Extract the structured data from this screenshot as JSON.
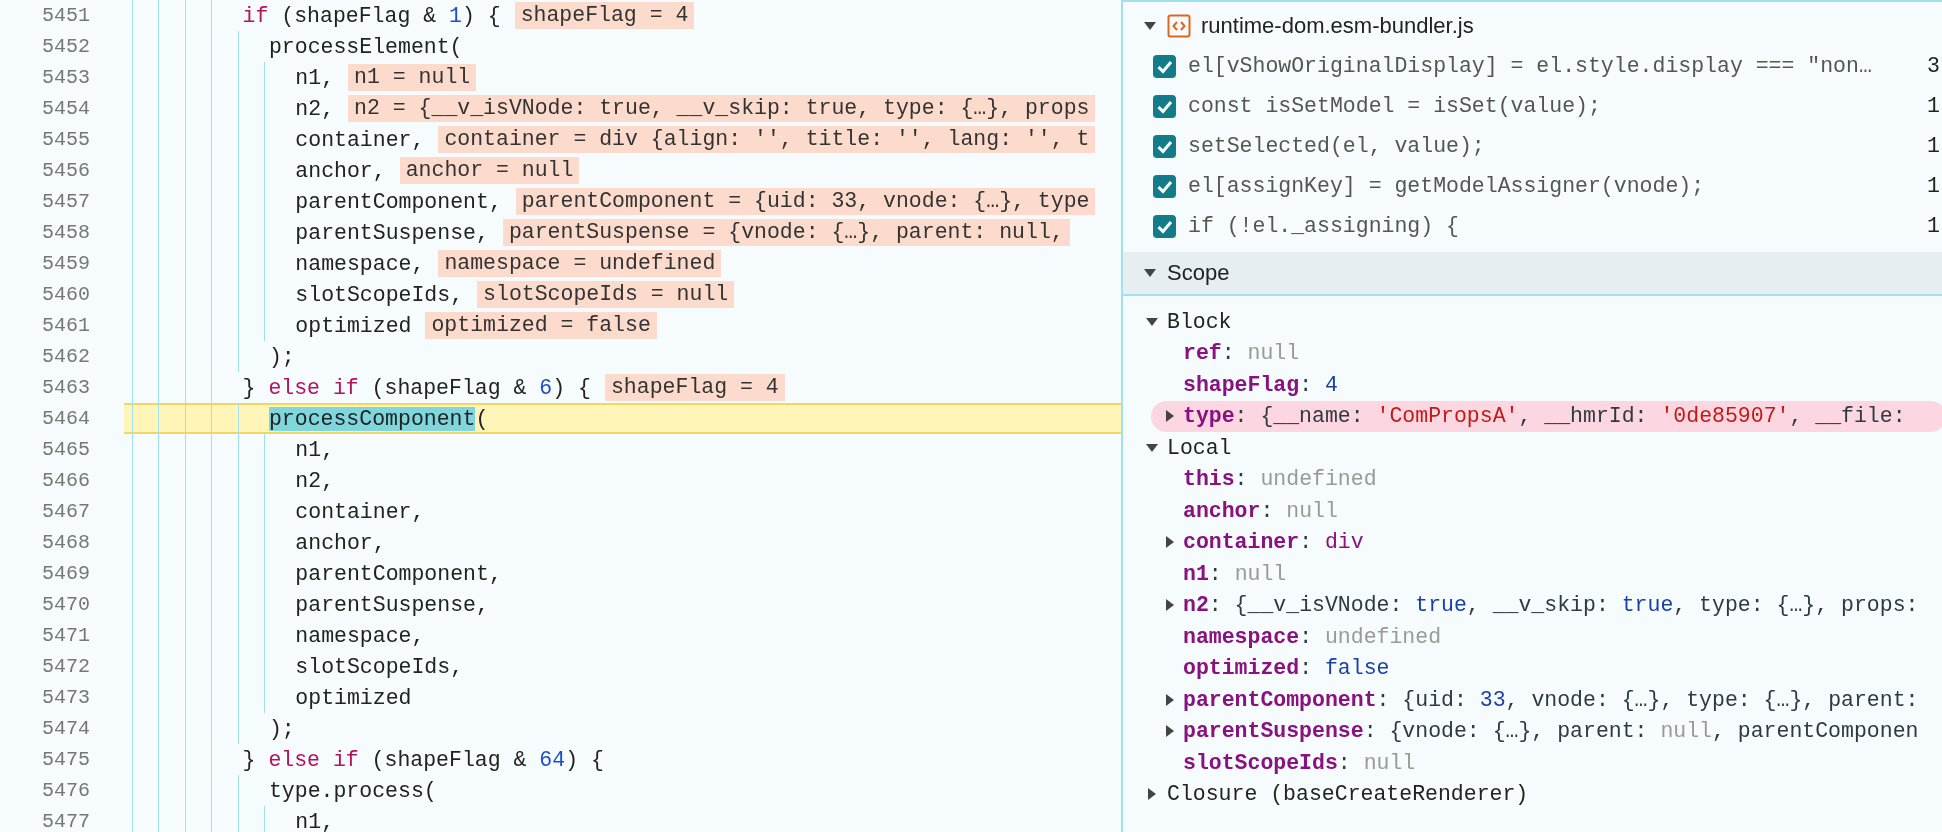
{
  "editor": {
    "lines": [
      {
        "number": "5451",
        "current": false,
        "tokens": [
          {
            "text": "if",
            "kind": "keyword"
          },
          {
            "text": " (shapeFlag & ",
            "kind": "plain"
          },
          {
            "text": "1",
            "kind": "number"
          },
          {
            "text": ") {",
            "kind": "plain"
          }
        ],
        "value": "shapeFlag = 4",
        "children": [
          {
            "number": "5452",
            "current": false,
            "tokens": [
              {
                "text": "processElement(",
                "kind": "plain"
              }
            ],
            "children": [
              {
                "number": "5453",
                "current": false,
                "tokens": [
                  {
                    "text": "n1,",
                    "kind": "plain"
                  }
                ],
                "value": "n1 = null"
              },
              {
                "number": "5454",
                "current": false,
                "tokens": [
                  {
                    "text": "n2,",
                    "kind": "plain"
                  }
                ],
                "value": "n2 = {__v_isVNode: true, __v_skip: true, type: {…}, props"
              },
              {
                "number": "5455",
                "current": false,
                "tokens": [
                  {
                    "text": "container,",
                    "kind": "plain"
                  }
                ],
                "value": "container = div {align: '', title: '', lang: '', t"
              },
              {
                "number": "5456",
                "current": false,
                "tokens": [
                  {
                    "text": "anchor,",
                    "kind": "plain"
                  }
                ],
                "value": "anchor = null"
              },
              {
                "number": "5457",
                "current": false,
                "tokens": [
                  {
                    "text": "parentComponent,",
                    "kind": "plain"
                  }
                ],
                "value": "parentComponent = {uid: 33, vnode: {…}, type"
              },
              {
                "number": "5458",
                "current": false,
                "tokens": [
                  {
                    "text": "parentSuspense,",
                    "kind": "plain"
                  }
                ],
                "value": "parentSuspense = {vnode: {…}, parent: null,"
              },
              {
                "number": "5459",
                "current": false,
                "tokens": [
                  {
                    "text": "namespace,",
                    "kind": "plain"
                  }
                ],
                "value": "namespace = undefined"
              },
              {
                "number": "5460",
                "current": false,
                "tokens": [
                  {
                    "text": "slotScopeIds,",
                    "kind": "plain"
                  }
                ],
                "value": "slotScopeIds = null"
              },
              {
                "number": "5461",
                "current": false,
                "tokens": [
                  {
                    "text": "optimized",
                    "kind": "plain"
                  }
                ],
                "value": "optimized = false"
              }
            ]
          },
          {
            "number": "5462",
            "current": false,
            "tokens": [
              {
                "text": ");",
                "kind": "plain"
              }
            ]
          }
        ]
      },
      {
        "number": "5463",
        "current": false,
        "tokens": [
          {
            "text": "} ",
            "kind": "plain"
          },
          {
            "text": "else if",
            "kind": "keyword"
          },
          {
            "text": " (shapeFlag & ",
            "kind": "plain"
          },
          {
            "text": "6",
            "kind": "number"
          },
          {
            "text": ") {",
            "kind": "plain"
          }
        ],
        "value": "shapeFlag = 4",
        "children": [
          {
            "number": "5464",
            "current": true,
            "tokens": [
              {
                "text": "processComponent",
                "kind": "match"
              },
              {
                "text": "(",
                "kind": "plain"
              }
            ],
            "children": [
              {
                "number": "5465",
                "current": false,
                "tokens": [
                  {
                    "text": "n1,",
                    "kind": "plain"
                  }
                ]
              },
              {
                "number": "5466",
                "current": false,
                "tokens": [
                  {
                    "text": "n2,",
                    "kind": "plain"
                  }
                ]
              },
              {
                "number": "5467",
                "current": false,
                "tokens": [
                  {
                    "text": "container,",
                    "kind": "plain"
                  }
                ]
              },
              {
                "number": "5468",
                "current": false,
                "tokens": [
                  {
                    "text": "anchor,",
                    "kind": "plain"
                  }
                ]
              },
              {
                "number": "5469",
                "current": false,
                "tokens": [
                  {
                    "text": "parentComponent,",
                    "kind": "plain"
                  }
                ]
              },
              {
                "number": "5470",
                "current": false,
                "tokens": [
                  {
                    "text": "parentSuspense,",
                    "kind": "plain"
                  }
                ]
              },
              {
                "number": "5471",
                "current": false,
                "tokens": [
                  {
                    "text": "namespace,",
                    "kind": "plain"
                  }
                ]
              },
              {
                "number": "5472",
                "current": false,
                "tokens": [
                  {
                    "text": "slotScopeIds,",
                    "kind": "plain"
                  }
                ]
              },
              {
                "number": "5473",
                "current": false,
                "tokens": [
                  {
                    "text": "optimized",
                    "kind": "plain"
                  }
                ]
              }
            ]
          },
          {
            "number": "5474",
            "current": false,
            "tokens": [
              {
                "text": ");",
                "kind": "plain"
              }
            ]
          }
        ]
      },
      {
        "number": "5475",
        "current": false,
        "tokens": [
          {
            "text": "} ",
            "kind": "plain"
          },
          {
            "text": "else if",
            "kind": "keyword"
          },
          {
            "text": " (shapeFlag & ",
            "kind": "plain"
          },
          {
            "text": "64",
            "kind": "number"
          },
          {
            "text": ") {",
            "kind": "plain"
          }
        ],
        "children": [
          {
            "number": "5476",
            "current": false,
            "tokens": [
              {
                "text": "type.process(",
                "kind": "plain"
              }
            ],
            "children": [
              {
                "number": "5477",
                "current": false,
                "tokens": [
                  {
                    "text": "n1,",
                    "kind": "plain"
                  }
                ]
              }
            ]
          }
        ]
      }
    ]
  },
  "debugger": {
    "breakpoints": {
      "file": "runtime-dom.esm-bundler.js",
      "expanded": true,
      "items": [
        {
          "code": "el[vShowOriginalDisplay] = el.style.display === \"non…",
          "line": "3",
          "checked": true
        },
        {
          "code": "const isSetModel = isSet(value);",
          "line": "1",
          "checked": true
        },
        {
          "code": "setSelected(el, value);",
          "line": "1",
          "checked": true
        },
        {
          "code": "el[assignKey] = getModelAssigner(vnode);",
          "line": "1",
          "checked": true
        },
        {
          "code": "if (!el._assigning) {",
          "line": "1",
          "checked": true
        }
      ]
    },
    "scope": {
      "title": "Scope",
      "expanded": true,
      "groups": [
        {
          "name": "Block",
          "expanded": true,
          "entries": [
            {
              "expandable": false,
              "highlighted": false,
              "tokens": [
                {
                  "text": "ref",
                  "kind": "key"
                },
                {
                  "text": ": ",
                  "kind": "plain"
                },
                {
                  "text": "null",
                  "kind": "null"
                }
              ]
            },
            {
              "expandable": false,
              "highlighted": false,
              "tokens": [
                {
                  "text": "shapeFlag",
                  "kind": "key"
                },
                {
                  "text": ": ",
                  "kind": "plain"
                },
                {
                  "text": "4",
                  "kind": "number"
                }
              ]
            },
            {
              "expandable": true,
              "highlighted": true,
              "tokens": [
                {
                  "text": "type",
                  "kind": "key"
                },
                {
                  "text": ": {__name: ",
                  "kind": "plain"
                },
                {
                  "text": "'ComPropsA'",
                  "kind": "string"
                },
                {
                  "text": ", __hmrId: ",
                  "kind": "plain"
                },
                {
                  "text": "'0de85907'",
                  "kind": "string"
                },
                {
                  "text": ", __file:",
                  "kind": "plain"
                }
              ]
            }
          ]
        },
        {
          "name": "Local",
          "expanded": true,
          "entries": [
            {
              "expandable": false,
              "highlighted": false,
              "tokens": [
                {
                  "text": "this",
                  "kind": "key"
                },
                {
                  "text": ": ",
                  "kind": "plain"
                },
                {
                  "text": "undefined",
                  "kind": "null"
                }
              ]
            },
            {
              "expandable": false,
              "highlighted": false,
              "tokens": [
                {
                  "text": "anchor",
                  "kind": "key"
                },
                {
                  "text": ": ",
                  "kind": "plain"
                },
                {
                  "text": "null",
                  "kind": "null"
                }
              ]
            },
            {
              "expandable": true,
              "highlighted": false,
              "tokens": [
                {
                  "text": "container",
                  "kind": "key"
                },
                {
                  "text": ": ",
                  "kind": "plain"
                },
                {
                  "text": "div",
                  "kind": "tag"
                }
              ]
            },
            {
              "expandable": false,
              "highlighted": false,
              "tokens": [
                {
                  "text": "n1",
                  "kind": "key"
                },
                {
                  "text": ": ",
                  "kind": "plain"
                },
                {
                  "text": "null",
                  "kind": "null"
                }
              ]
            },
            {
              "expandable": true,
              "highlighted": false,
              "tokens": [
                {
                  "text": "n2",
                  "kind": "key"
                },
                {
                  "text": ": {__v_isVNode: ",
                  "kind": "plain"
                },
                {
                  "text": "true",
                  "kind": "number"
                },
                {
                  "text": ", __v_skip: ",
                  "kind": "plain"
                },
                {
                  "text": "true",
                  "kind": "number"
                },
                {
                  "text": ", type: {…}, props:",
                  "kind": "plain"
                }
              ]
            },
            {
              "expandable": false,
              "highlighted": false,
              "tokens": [
                {
                  "text": "namespace",
                  "kind": "key"
                },
                {
                  "text": ": ",
                  "kind": "plain"
                },
                {
                  "text": "undefined",
                  "kind": "null"
                }
              ]
            },
            {
              "expandable": false,
              "highlighted": false,
              "tokens": [
                {
                  "text": "optimized",
                  "kind": "key"
                },
                {
                  "text": ": ",
                  "kind": "plain"
                },
                {
                  "text": "false",
                  "kind": "number"
                }
              ]
            },
            {
              "expandable": true,
              "highlighted": false,
              "tokens": [
                {
                  "text": "parentComponent",
                  "kind": "key"
                },
                {
                  "text": ": {uid: ",
                  "kind": "plain"
                },
                {
                  "text": "33",
                  "kind": "number"
                },
                {
                  "text": ", vnode: {…}, type: {…}, parent:",
                  "kind": "plain"
                }
              ]
            },
            {
              "expandable": true,
              "highlighted": false,
              "tokens": [
                {
                  "text": "parentSuspense",
                  "kind": "key"
                },
                {
                  "text": ": {vnode: {…}, parent: ",
                  "kind": "plain"
                },
                {
                  "text": "null",
                  "kind": "null"
                },
                {
                  "text": ", parentComponen",
                  "kind": "plain"
                }
              ]
            },
            {
              "expandable": false,
              "highlighted": false,
              "tokens": [
                {
                  "text": "slotScopeIds",
                  "kind": "key"
                },
                {
                  "text": ": ",
                  "kind": "plain"
                },
                {
                  "text": "null",
                  "kind": "null"
                }
              ]
            }
          ]
        },
        {
          "name": "Closure (baseCreateRenderer)",
          "expanded": false
        }
      ]
    }
  }
}
